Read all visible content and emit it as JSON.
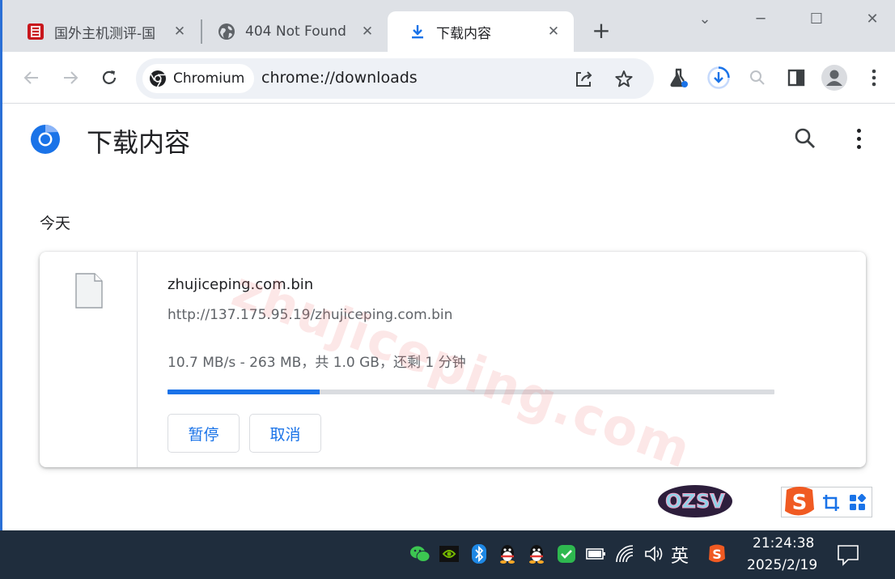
{
  "tabs": [
    {
      "title": "国外主机测评-国",
      "icon": "site-favicon-red",
      "close": "✕"
    },
    {
      "title": "404 Not Found",
      "icon": "globe-icon",
      "close": "✕"
    },
    {
      "title": "下载内容",
      "icon": "download-icon",
      "close": "✕",
      "active": true
    }
  ],
  "new_tab_label": "+",
  "window_controls": {
    "minimize": "─",
    "maximize": "☐",
    "close": "✕",
    "tab_search": "⌄"
  },
  "omnibox": {
    "chip_label": "Chromium",
    "url": "chrome://downloads"
  },
  "page": {
    "title": "下载内容",
    "date_header": "今天"
  },
  "download": {
    "file_name": "zhujiceping.com.bin",
    "url": "http://137.175.95.19/zhujiceping.com.bin",
    "status": "10.7 MB/s - 263 MB，共 1.0 GB，还剩 1 分钟",
    "progress_percent": 25,
    "pause_label": "暂停",
    "cancel_label": "取消"
  },
  "watermark": "zhujiceping.com",
  "sticker_text": "OZSV",
  "taskbar": {
    "ime_lang": "英",
    "time": "21:24:38",
    "date": "2025/2/19"
  },
  "colors": {
    "accent": "#1a73e8",
    "tabstrip": "#dee1e6",
    "taskbar": "#1f2d3d"
  }
}
